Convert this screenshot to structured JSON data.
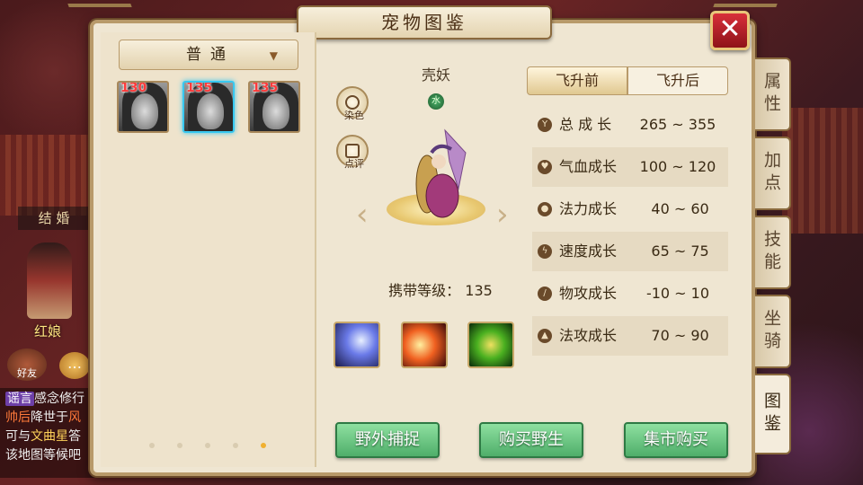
{
  "window": {
    "title": "宠物图鉴",
    "close_icon": "close-icon"
  },
  "background": {
    "npc_plaque": "结 婚",
    "npc_name": "红娘",
    "friend_label": "好友",
    "chat_lines": [
      {
        "tag": "谣言",
        "text": "感念修行"
      },
      {
        "hl": "帅后",
        "text": "降世于",
        "hl2": "风"
      },
      {
        "text": "可与",
        "gold": "文曲星",
        "text2": "答"
      },
      {
        "text": "该地图等候吧"
      }
    ]
  },
  "filter": {
    "selected": "普通",
    "arrow": "▼"
  },
  "pets": [
    {
      "level": "130",
      "selected": false
    },
    {
      "level": "135",
      "selected": true
    },
    {
      "level": "135",
      "selected": false
    }
  ],
  "pagination": {
    "count": 5,
    "current": 5
  },
  "detail": {
    "name": "壳妖",
    "element": "水",
    "dye_label": "染色",
    "comment_label": "点评",
    "carry_level_label": "携带等级：",
    "carry_level": "135",
    "skills": [
      "skill-1",
      "skill-2",
      "skill-3"
    ]
  },
  "tabs": {
    "before": "飞升前",
    "after": "飞升后",
    "active": "before"
  },
  "stats": [
    {
      "name": "总 成 长",
      "range": "265 ~ 355",
      "icon": "growth-icon"
    },
    {
      "name": "气血成长",
      "range": "100 ~ 120",
      "icon": "heart-icon"
    },
    {
      "name": "法力成长",
      "range": " 40 ~ 60",
      "icon": "drop-icon"
    },
    {
      "name": "速度成长",
      "range": " 65 ~ 75",
      "icon": "lightning-icon"
    },
    {
      "name": "物攻成长",
      "range": "-10 ~ 10",
      "icon": "sword-icon"
    },
    {
      "name": "法攻成长",
      "range": " 70 ~ 90",
      "icon": "flame-icon"
    }
  ],
  "side_tabs": [
    "属性",
    "加点",
    "技能",
    "坐骑",
    "图鉴"
  ],
  "side_tab_active": "图鉴",
  "actions": {
    "wild_capture": "野外捕捉",
    "buy_wild": "购买野生",
    "market_buy": "集市购买"
  },
  "colors": {
    "accent_green": "#4fae6a",
    "close_red": "#c8202a",
    "selection_blue": "#38c8f0",
    "level_red": "#ff3a3a"
  }
}
